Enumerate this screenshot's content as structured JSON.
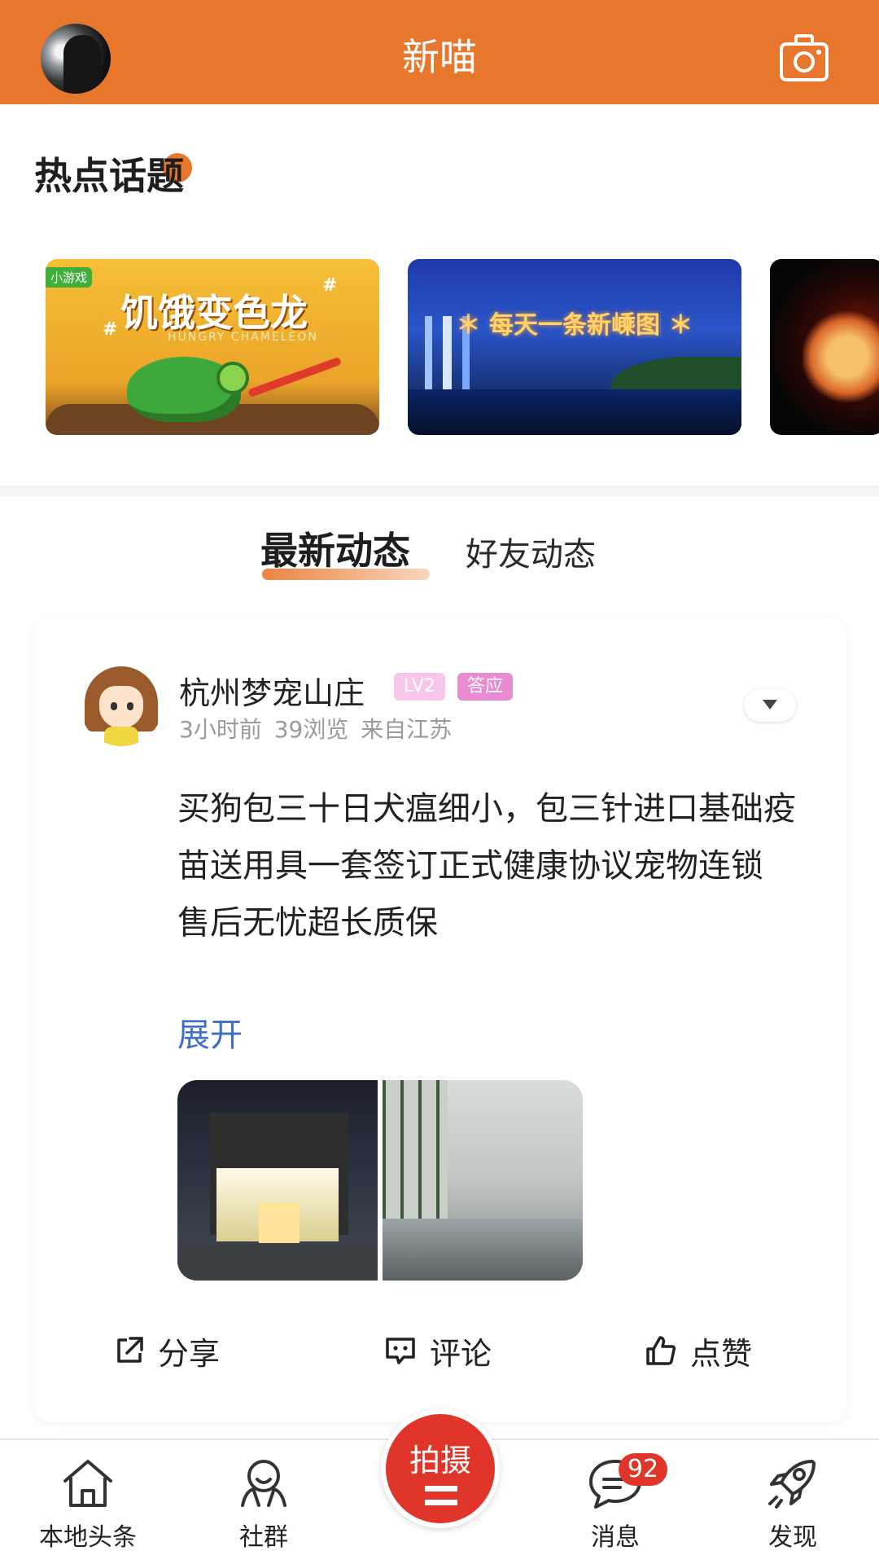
{
  "header": {
    "title": "新喵",
    "camera_icon": "camera-icon"
  },
  "hot_topics": {
    "title": "热点话题",
    "cards": [
      {
        "badge": "小游戏",
        "title": "饥饿变色龙",
        "subtitle": "HUNGRY CHAMELEON",
        "hash": "#"
      },
      {
        "title": "＊ 每天一条新嵊图 ＊"
      },
      {
        "title": ""
      }
    ]
  },
  "tabs": {
    "latest": "最新动态",
    "friends": "好友动态"
  },
  "post": {
    "username": "杭州梦宠山庄",
    "level": "LV2",
    "tag": "答应",
    "time": "3小时前",
    "views": "39浏览",
    "location": "来自江苏",
    "text": "买狗包三十日犬瘟细小，包三针进口基础疫苗送用具一套签订正式健康协议宠物连锁 售后无忧超长质保",
    "expand": "展开",
    "actions": {
      "share": "分享",
      "comment": "评论",
      "like": "点赞"
    }
  },
  "bottom_nav": {
    "home": "本地头条",
    "group": "社群",
    "capture": "拍摄",
    "messages": "消息",
    "messages_badge": "92",
    "discover": "发现"
  },
  "colors": {
    "brand": "#e8772e",
    "capture": "#e0352b",
    "link": "#3f6ec4"
  }
}
